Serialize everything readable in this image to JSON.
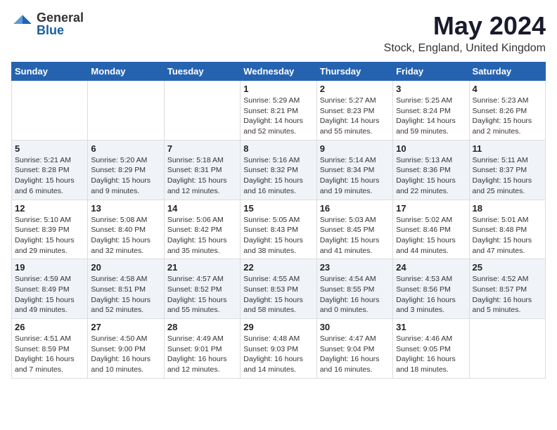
{
  "header": {
    "logo_general": "General",
    "logo_blue": "Blue",
    "title": "May 2024",
    "subtitle": "Stock, England, United Kingdom"
  },
  "days_of_week": [
    "Sunday",
    "Monday",
    "Tuesday",
    "Wednesday",
    "Thursday",
    "Friday",
    "Saturday"
  ],
  "weeks": [
    [
      {
        "day": "",
        "detail": ""
      },
      {
        "day": "",
        "detail": ""
      },
      {
        "day": "",
        "detail": ""
      },
      {
        "day": "1",
        "detail": "Sunrise: 5:29 AM\nSunset: 8:21 PM\nDaylight: 14 hours\nand 52 minutes."
      },
      {
        "day": "2",
        "detail": "Sunrise: 5:27 AM\nSunset: 8:23 PM\nDaylight: 14 hours\nand 55 minutes."
      },
      {
        "day": "3",
        "detail": "Sunrise: 5:25 AM\nSunset: 8:24 PM\nDaylight: 14 hours\nand 59 minutes."
      },
      {
        "day": "4",
        "detail": "Sunrise: 5:23 AM\nSunset: 8:26 PM\nDaylight: 15 hours\nand 2 minutes."
      }
    ],
    [
      {
        "day": "5",
        "detail": "Sunrise: 5:21 AM\nSunset: 8:28 PM\nDaylight: 15 hours\nand 6 minutes."
      },
      {
        "day": "6",
        "detail": "Sunrise: 5:20 AM\nSunset: 8:29 PM\nDaylight: 15 hours\nand 9 minutes."
      },
      {
        "day": "7",
        "detail": "Sunrise: 5:18 AM\nSunset: 8:31 PM\nDaylight: 15 hours\nand 12 minutes."
      },
      {
        "day": "8",
        "detail": "Sunrise: 5:16 AM\nSunset: 8:32 PM\nDaylight: 15 hours\nand 16 minutes."
      },
      {
        "day": "9",
        "detail": "Sunrise: 5:14 AM\nSunset: 8:34 PM\nDaylight: 15 hours\nand 19 minutes."
      },
      {
        "day": "10",
        "detail": "Sunrise: 5:13 AM\nSunset: 8:36 PM\nDaylight: 15 hours\nand 22 minutes."
      },
      {
        "day": "11",
        "detail": "Sunrise: 5:11 AM\nSunset: 8:37 PM\nDaylight: 15 hours\nand 25 minutes."
      }
    ],
    [
      {
        "day": "12",
        "detail": "Sunrise: 5:10 AM\nSunset: 8:39 PM\nDaylight: 15 hours\nand 29 minutes."
      },
      {
        "day": "13",
        "detail": "Sunrise: 5:08 AM\nSunset: 8:40 PM\nDaylight: 15 hours\nand 32 minutes."
      },
      {
        "day": "14",
        "detail": "Sunrise: 5:06 AM\nSunset: 8:42 PM\nDaylight: 15 hours\nand 35 minutes."
      },
      {
        "day": "15",
        "detail": "Sunrise: 5:05 AM\nSunset: 8:43 PM\nDaylight: 15 hours\nand 38 minutes."
      },
      {
        "day": "16",
        "detail": "Sunrise: 5:03 AM\nSunset: 8:45 PM\nDaylight: 15 hours\nand 41 minutes."
      },
      {
        "day": "17",
        "detail": "Sunrise: 5:02 AM\nSunset: 8:46 PM\nDaylight: 15 hours\nand 44 minutes."
      },
      {
        "day": "18",
        "detail": "Sunrise: 5:01 AM\nSunset: 8:48 PM\nDaylight: 15 hours\nand 47 minutes."
      }
    ],
    [
      {
        "day": "19",
        "detail": "Sunrise: 4:59 AM\nSunset: 8:49 PM\nDaylight: 15 hours\nand 49 minutes."
      },
      {
        "day": "20",
        "detail": "Sunrise: 4:58 AM\nSunset: 8:51 PM\nDaylight: 15 hours\nand 52 minutes."
      },
      {
        "day": "21",
        "detail": "Sunrise: 4:57 AM\nSunset: 8:52 PM\nDaylight: 15 hours\nand 55 minutes."
      },
      {
        "day": "22",
        "detail": "Sunrise: 4:55 AM\nSunset: 8:53 PM\nDaylight: 15 hours\nand 58 minutes."
      },
      {
        "day": "23",
        "detail": "Sunrise: 4:54 AM\nSunset: 8:55 PM\nDaylight: 16 hours\nand 0 minutes."
      },
      {
        "day": "24",
        "detail": "Sunrise: 4:53 AM\nSunset: 8:56 PM\nDaylight: 16 hours\nand 3 minutes."
      },
      {
        "day": "25",
        "detail": "Sunrise: 4:52 AM\nSunset: 8:57 PM\nDaylight: 16 hours\nand 5 minutes."
      }
    ],
    [
      {
        "day": "26",
        "detail": "Sunrise: 4:51 AM\nSunset: 8:59 PM\nDaylight: 16 hours\nand 7 minutes."
      },
      {
        "day": "27",
        "detail": "Sunrise: 4:50 AM\nSunset: 9:00 PM\nDaylight: 16 hours\nand 10 minutes."
      },
      {
        "day": "28",
        "detail": "Sunrise: 4:49 AM\nSunset: 9:01 PM\nDaylight: 16 hours\nand 12 minutes."
      },
      {
        "day": "29",
        "detail": "Sunrise: 4:48 AM\nSunset: 9:03 PM\nDaylight: 16 hours\nand 14 minutes."
      },
      {
        "day": "30",
        "detail": "Sunrise: 4:47 AM\nSunset: 9:04 PM\nDaylight: 16 hours\nand 16 minutes."
      },
      {
        "day": "31",
        "detail": "Sunrise: 4:46 AM\nSunset: 9:05 PM\nDaylight: 16 hours\nand 18 minutes."
      },
      {
        "day": "",
        "detail": ""
      }
    ]
  ]
}
